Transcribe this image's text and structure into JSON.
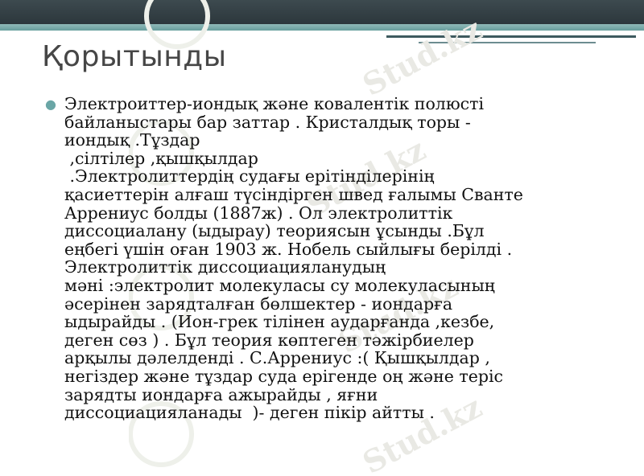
{
  "slide": {
    "title": "Қорытынды",
    "watermark_text": "Stud.kz",
    "lines": [
      "Электроиттер-иондық және ковалентік полюсті",
      "байланыстары бар заттар . Кристалдық торы -",
      "иондық .Тұздар",
      " ,сілтілер ,қышқылдар",
      " .Электролиттердің судағы ерітінділерінің",
      "қасиеттерін алғаш түсіндірген швед ғалымы Сванте",
      "Аррениус болды (1887ж) . Ол электролиттік",
      "диссоциалану (ыдырау) теориясын ұсынды .Бұл",
      "еңбегі үшін оған 1903 ж. Нобель сыйлығы берілді .",
      "Электролиттік диссоциацияланудың",
      "мәні :электролит молекуласы су молекуласының",
      "әсерінен зарядталған бөлшектер - иондарға",
      "ыдырайды . (Ион-грек тілінен аударғанда ,кезбе,",
      "деген сөз ) . Бұл теория көптеген тәжірбиелер",
      "арқылы дәлелденді . С.Аррениус :( Қышқылдар ,",
      "негіздер және тұздар суда ерігенде оң және теріс",
      "зарядты иондарға ажырайды , яғни",
      "диссоциацияланады  )- деген пікір айтты ."
    ]
  },
  "colors": {
    "top_bar": "#2c373c",
    "accent_teal": "#6aa6a6",
    "title_text": "#464646",
    "body_text": "#111111"
  }
}
